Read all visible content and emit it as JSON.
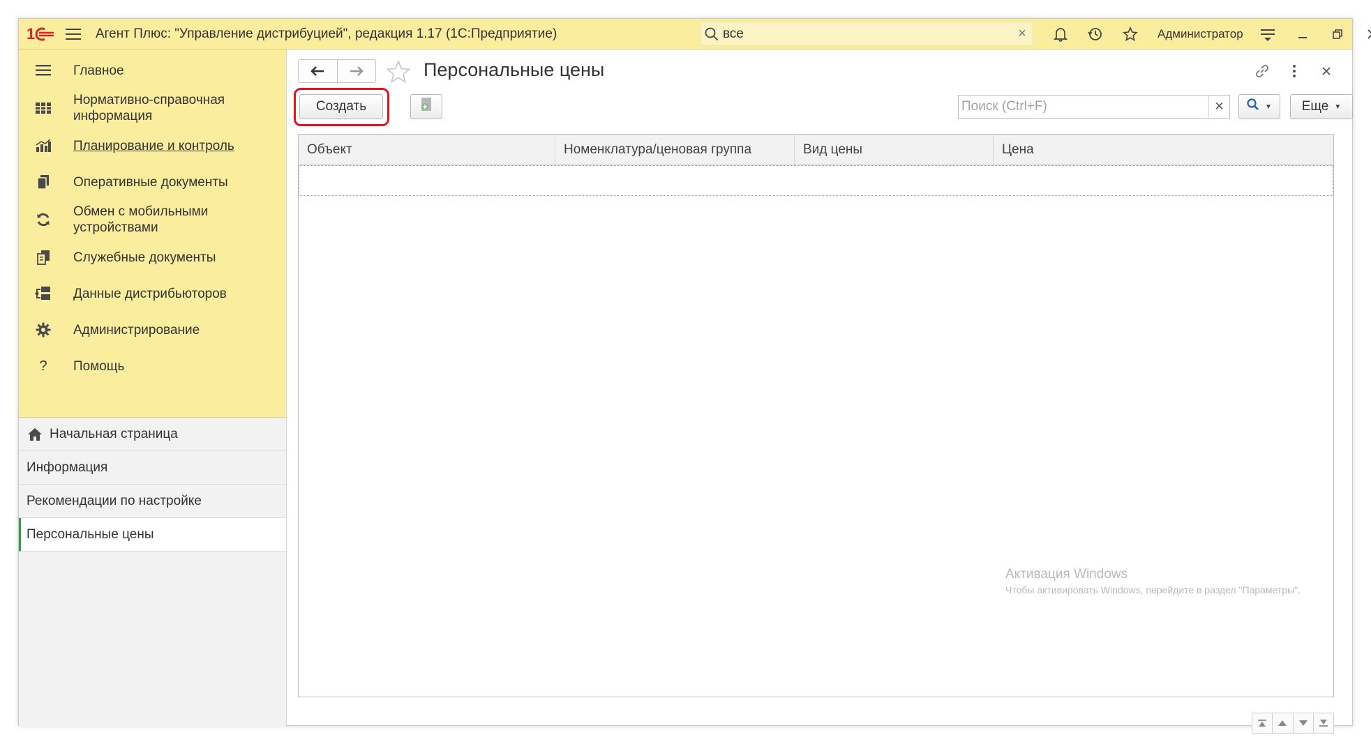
{
  "window": {
    "title": "Агент Плюс: \"Управление дистрибуцией\", редакция 1.17  (1С:Предприятие)",
    "search_value": "все",
    "user": "Администратор",
    "brand_color": "#fbed9e",
    "accent_red": "#e0141c"
  },
  "sidebar": {
    "sections": [
      {
        "label": "Главное",
        "icon": "menu-lines-icon"
      },
      {
        "label": "Нормативно-справочная информация",
        "icon": "reference-icon"
      },
      {
        "label": "Планирование и контроль",
        "icon": "bar-chart-icon"
      },
      {
        "label": "Оперативные документы",
        "icon": "documents-icon"
      },
      {
        "label": "Обмен с мобильными устройствами",
        "icon": "sync-icon"
      },
      {
        "label": "Служебные документы",
        "icon": "service-docs-icon"
      },
      {
        "label": "Данные дистрибьюторов",
        "icon": "distributor-data-icon"
      },
      {
        "label": "Администрирование",
        "icon": "gear-icon"
      },
      {
        "label": "Помощь",
        "icon": "question-icon"
      }
    ],
    "open_windows": [
      {
        "label": "Начальная страница"
      },
      {
        "label": "Информация"
      },
      {
        "label": "Рекомендации по настройке"
      },
      {
        "label": "Персональные цены"
      }
    ]
  },
  "main": {
    "title": "Персональные цены",
    "create_label": "Создать",
    "search_placeholder": "Поиск (Ctrl+F)",
    "more_label": "Еще",
    "columns": [
      "Объект",
      "Номенклатура/ценовая группа",
      "Вид цены",
      "Цена"
    ],
    "rows": []
  },
  "overlay": {
    "activation_title": "Активация Windows",
    "activation_text": "Чтобы активировать Windows, перейдите в раздел \"Параметры\"."
  }
}
